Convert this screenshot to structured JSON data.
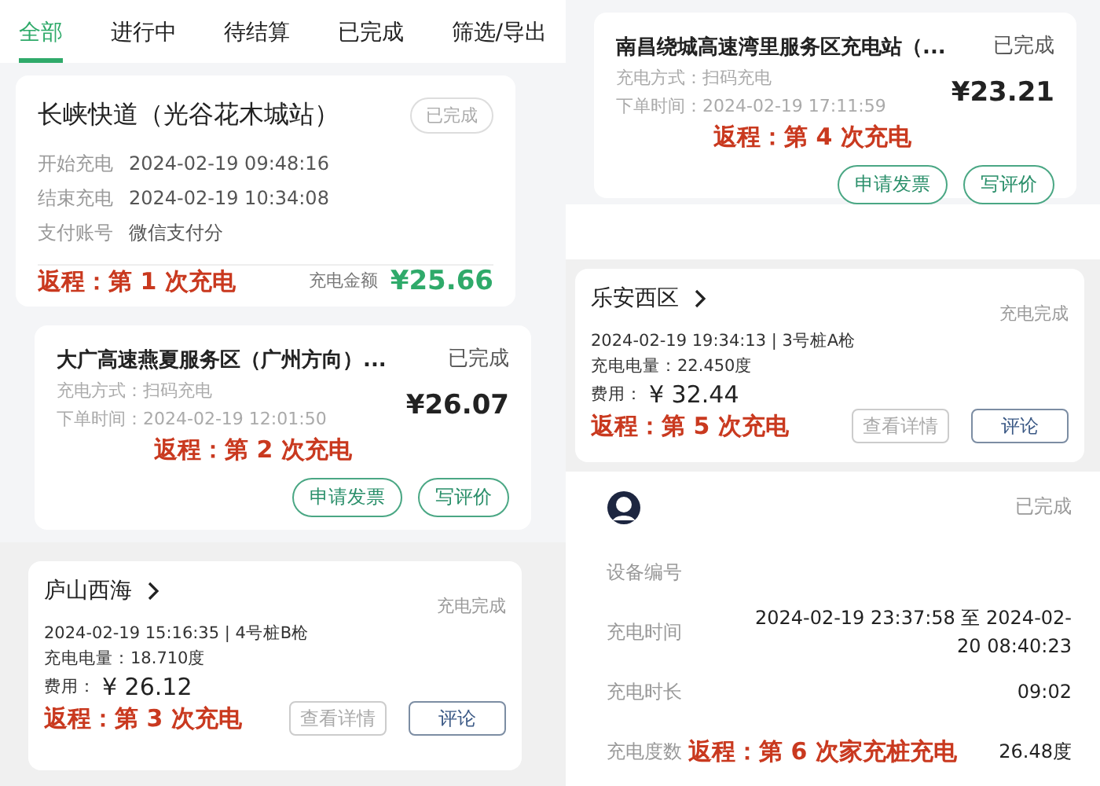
{
  "tabs": [
    {
      "label": "全部",
      "selected": true
    },
    {
      "label": "进行中",
      "selected": false
    },
    {
      "label": "待结算",
      "selected": false
    },
    {
      "label": "已完成",
      "selected": false
    },
    {
      "label": "筛选/导出",
      "selected": false
    }
  ],
  "left": [
    {
      "kind": "summary",
      "title": "长峡快道（光谷花木城站）",
      "status": "已完成",
      "rows": [
        {
          "label": "开始充电",
          "value": "2024-02-19 09:48:16"
        },
        {
          "label": "结束充电",
          "value": "2024-02-19 10:34:08"
        },
        {
          "label": "支付账号",
          "value": "微信支付分"
        }
      ],
      "note": "返程：第 1 次充电",
      "amount_label": "充电金额",
      "amount": "¥25.66"
    },
    {
      "kind": "order",
      "title": "大广高速燕夏服务区（广州方向）...",
      "status": "已完成",
      "lines": [
        "充电方式：扫码充电",
        "下单时间：2024-02-19 12:01:50"
      ],
      "price": "¥26.07",
      "note": "返程：第 2 次充电",
      "buttons": [
        {
          "label": "申请发票",
          "disabled": false
        },
        {
          "label": "写评价",
          "disabled": false
        }
      ]
    },
    {
      "kind": "session",
      "title": "庐山西海",
      "status": "充电完成",
      "meta": "2024-02-19 15:16:35 | 4号桩B枪",
      "energy": "充电电量：18.710度",
      "fee_label": "费用：",
      "fee": "¥ 26.12",
      "note": "返程：第 3 次充电",
      "buttons": [
        {
          "label": "查看详情",
          "disabled": true
        },
        {
          "label": "评论",
          "disabled": false
        }
      ]
    }
  ],
  "right": [
    {
      "kind": "order",
      "title": "南昌绕城高速湾里服务区充电站（...",
      "status": "已完成",
      "lines": [
        "充电方式：扫码充电",
        "下单时间：2024-02-19 17:11:59"
      ],
      "price": "¥23.21",
      "note": "返程：第 4 次充电",
      "buttons": [
        {
          "label": "申请发票",
          "disabled": false
        },
        {
          "label": "写评价",
          "disabled": false
        }
      ]
    },
    {
      "kind": "session",
      "title": "乐安西区",
      "status": "充电完成",
      "meta": "2024-02-19 19:34:13 | 3号桩A枪",
      "energy": "充电电量：22.450度",
      "fee_label": "费用：",
      "fee": "¥ 32.44",
      "note": "返程：第 5 次充电",
      "buttons": [
        {
          "label": "查看详情",
          "disabled": true
        },
        {
          "label": "评论",
          "disabled": false
        }
      ]
    },
    {
      "kind": "home",
      "status": "已完成",
      "rows": [
        {
          "label": "设备编号"
        },
        {
          "label": "充电时间",
          "value": "2024-02-19 23:37:58 至 2024-02-20 08:40:23"
        },
        {
          "label": "充电时长",
          "value": "09:02"
        },
        {
          "label": "充电度数",
          "value": "26.48度",
          "note": "返程：第 6 次家充桩充电"
        }
      ]
    }
  ]
}
